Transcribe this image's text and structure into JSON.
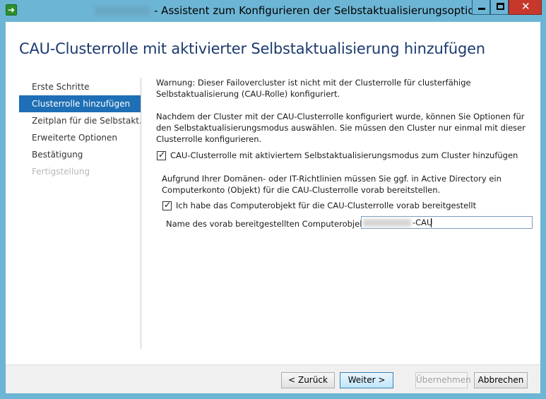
{
  "window": {
    "title": "- Assistent zum Konfigurieren der Selbstaktualisierungsoptionen",
    "icon": "wizard-arrow-icon"
  },
  "page": {
    "heading": "CAU-Clusterrolle mit aktivierter Selbstaktualisierung hinzufügen"
  },
  "nav": {
    "items": [
      {
        "label": "Erste Schritte",
        "state": "normal"
      },
      {
        "label": "Clusterrolle hinzufügen",
        "state": "selected"
      },
      {
        "label": "Zeitplan für die Selbstakt...",
        "state": "normal"
      },
      {
        "label": "Erweiterte Optionen",
        "state": "normal"
      },
      {
        "label": "Bestätigung",
        "state": "normal"
      },
      {
        "label": "Fertigstellung",
        "state": "disabled"
      }
    ]
  },
  "content": {
    "warning": "Warnung: Dieser Failovercluster ist nicht mit der Clusterrolle für clusterfähige Selbstaktualisierung (CAU-Rolle) konfiguriert.",
    "info": "Nachdem der Cluster mit der CAU-Clusterrolle konfiguriert wurde, können Sie Optionen für den Selbstaktualisierungsmodus auswählen. Sie müssen den Cluster nur einmal mit dieser Clusterrolle konfigurieren.",
    "add_role_checkbox": {
      "label": "CAU-Clusterrolle mit aktiviertem Selbstaktualisierungsmodus zum Cluster hinzufügen",
      "checked": true
    },
    "policy_note": "Aufgrund Ihrer Domänen- oder IT-Richtlinien müssen Sie ggf. in Active Directory ein Computerkonto (Objekt) für die CAU-Clusterrolle vorab bereitstellen.",
    "prestaged_checkbox": {
      "label": "Ich habe das Computerobjekt für die CAU-Clusterrolle vorab bereitgestellt",
      "checked": true
    },
    "computer_object_label": "Name des vorab bereitgestellten Computerobjekts:",
    "computer_object_value": "-CAU"
  },
  "footer": {
    "back": "< Zurück",
    "next": "Weiter >",
    "apply": "Übernehmen",
    "cancel": "Abbrechen"
  }
}
